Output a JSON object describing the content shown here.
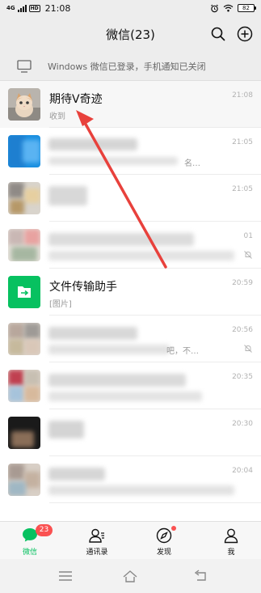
{
  "status_bar": {
    "signal": "4G",
    "hd": "HD",
    "time": "21:08",
    "battery": "82",
    "icons": [
      "alarm-icon",
      "wifi-icon",
      "battery-icon"
    ]
  },
  "header": {
    "title": "微信(23)",
    "icons": [
      "search-icon",
      "add-icon"
    ]
  },
  "login_banner": {
    "icon": "monitor-icon",
    "text": "Windows 微信已登录，手机通知已关闭"
  },
  "chats": [
    {
      "name": "期待V奇迹",
      "preview": "收到",
      "time": "21:08",
      "avatar": "kitten-photo"
    },
    {
      "name": "",
      "preview": "名…",
      "time": "21:05",
      "avatar": "blurred"
    },
    {
      "name": "",
      "preview": "",
      "time": "21:05",
      "avatar": "blurred"
    },
    {
      "name": "",
      "preview": "",
      "time": "01",
      "avatar": "blurred",
      "muted": true
    },
    {
      "name": "文件传输助手",
      "preview": "[图片]",
      "time": "20:59",
      "avatar": "file-transfer-icon"
    },
    {
      "name": "",
      "preview": "吧，不…",
      "time": "20:56",
      "avatar": "blurred",
      "muted": true
    },
    {
      "name": "",
      "preview": "",
      "time": "20:35",
      "avatar": "blurred"
    },
    {
      "name": "",
      "preview": "",
      "time": "20:30",
      "avatar": "blurred"
    },
    {
      "name": "",
      "preview": "",
      "time": "20:04",
      "avatar": "blurred"
    }
  ],
  "tabs": [
    {
      "label": "微信",
      "icon": "chat-bubble-icon",
      "badge": "23",
      "active": true
    },
    {
      "label": "通讯录",
      "icon": "contacts-icon"
    },
    {
      "label": "发现",
      "icon": "compass-icon",
      "dot": true
    },
    {
      "label": "我",
      "icon": "person-icon"
    }
  ],
  "system_nav": [
    "menu-icon",
    "home-icon",
    "back-icon"
  ],
  "colors": {
    "brand_green": "#07c160",
    "badge_red": "#fa5151",
    "annotation_red": "#e8413c",
    "background": "#ededed"
  }
}
